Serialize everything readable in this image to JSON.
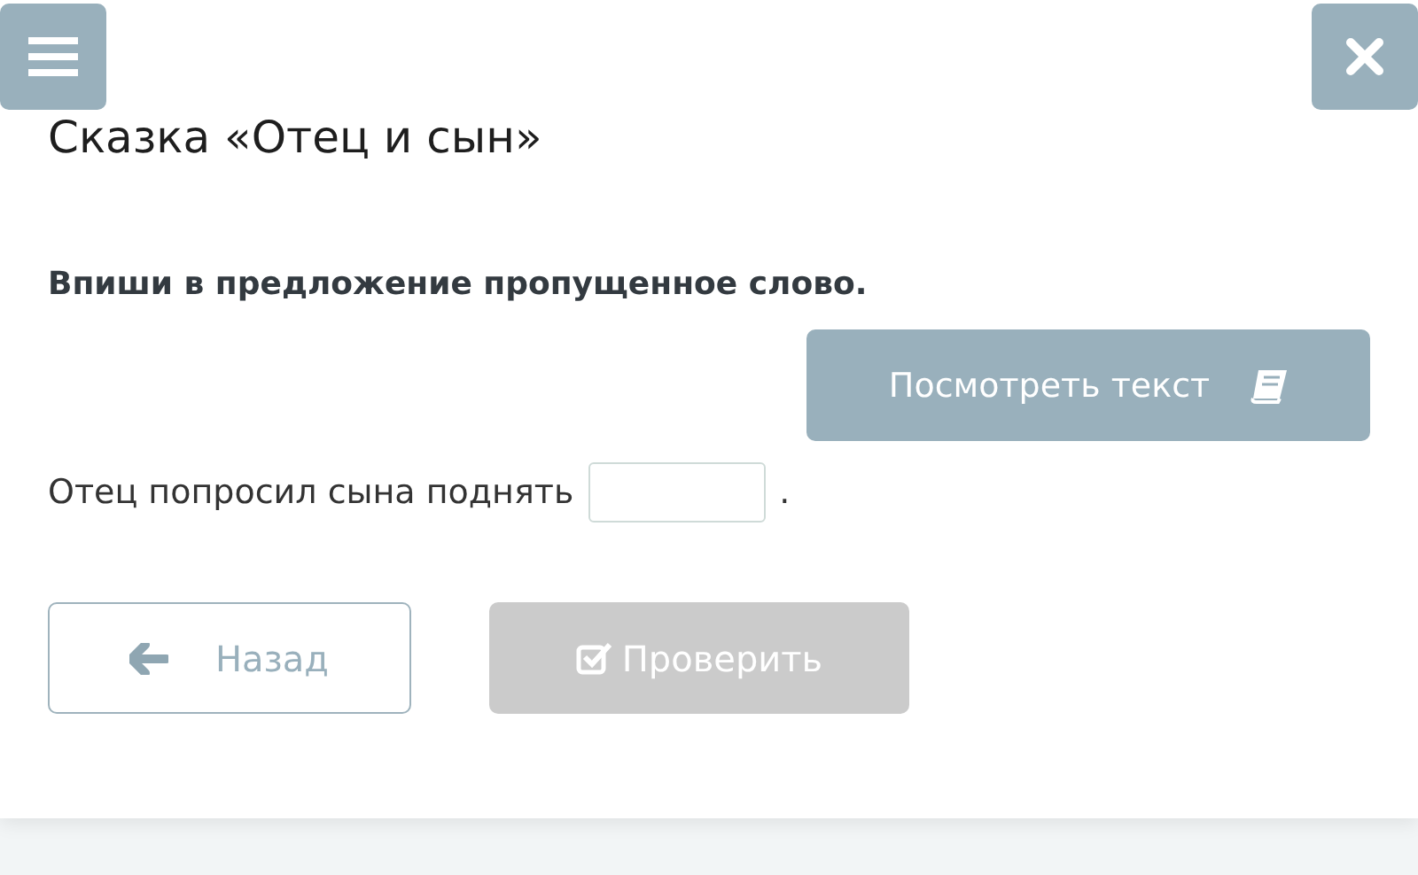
{
  "title": "Сказка «Отец и сын»",
  "instruction": "Впиши в предложение пропущенное слово.",
  "view_text_button": "Посмотреть текст",
  "sentence": {
    "before": "Отец попросил сына поднять",
    "after": "."
  },
  "back_button": {
    "label": "Назад",
    "disabled": false
  },
  "check_button": {
    "label": "Проверить",
    "disabled": true
  }
}
